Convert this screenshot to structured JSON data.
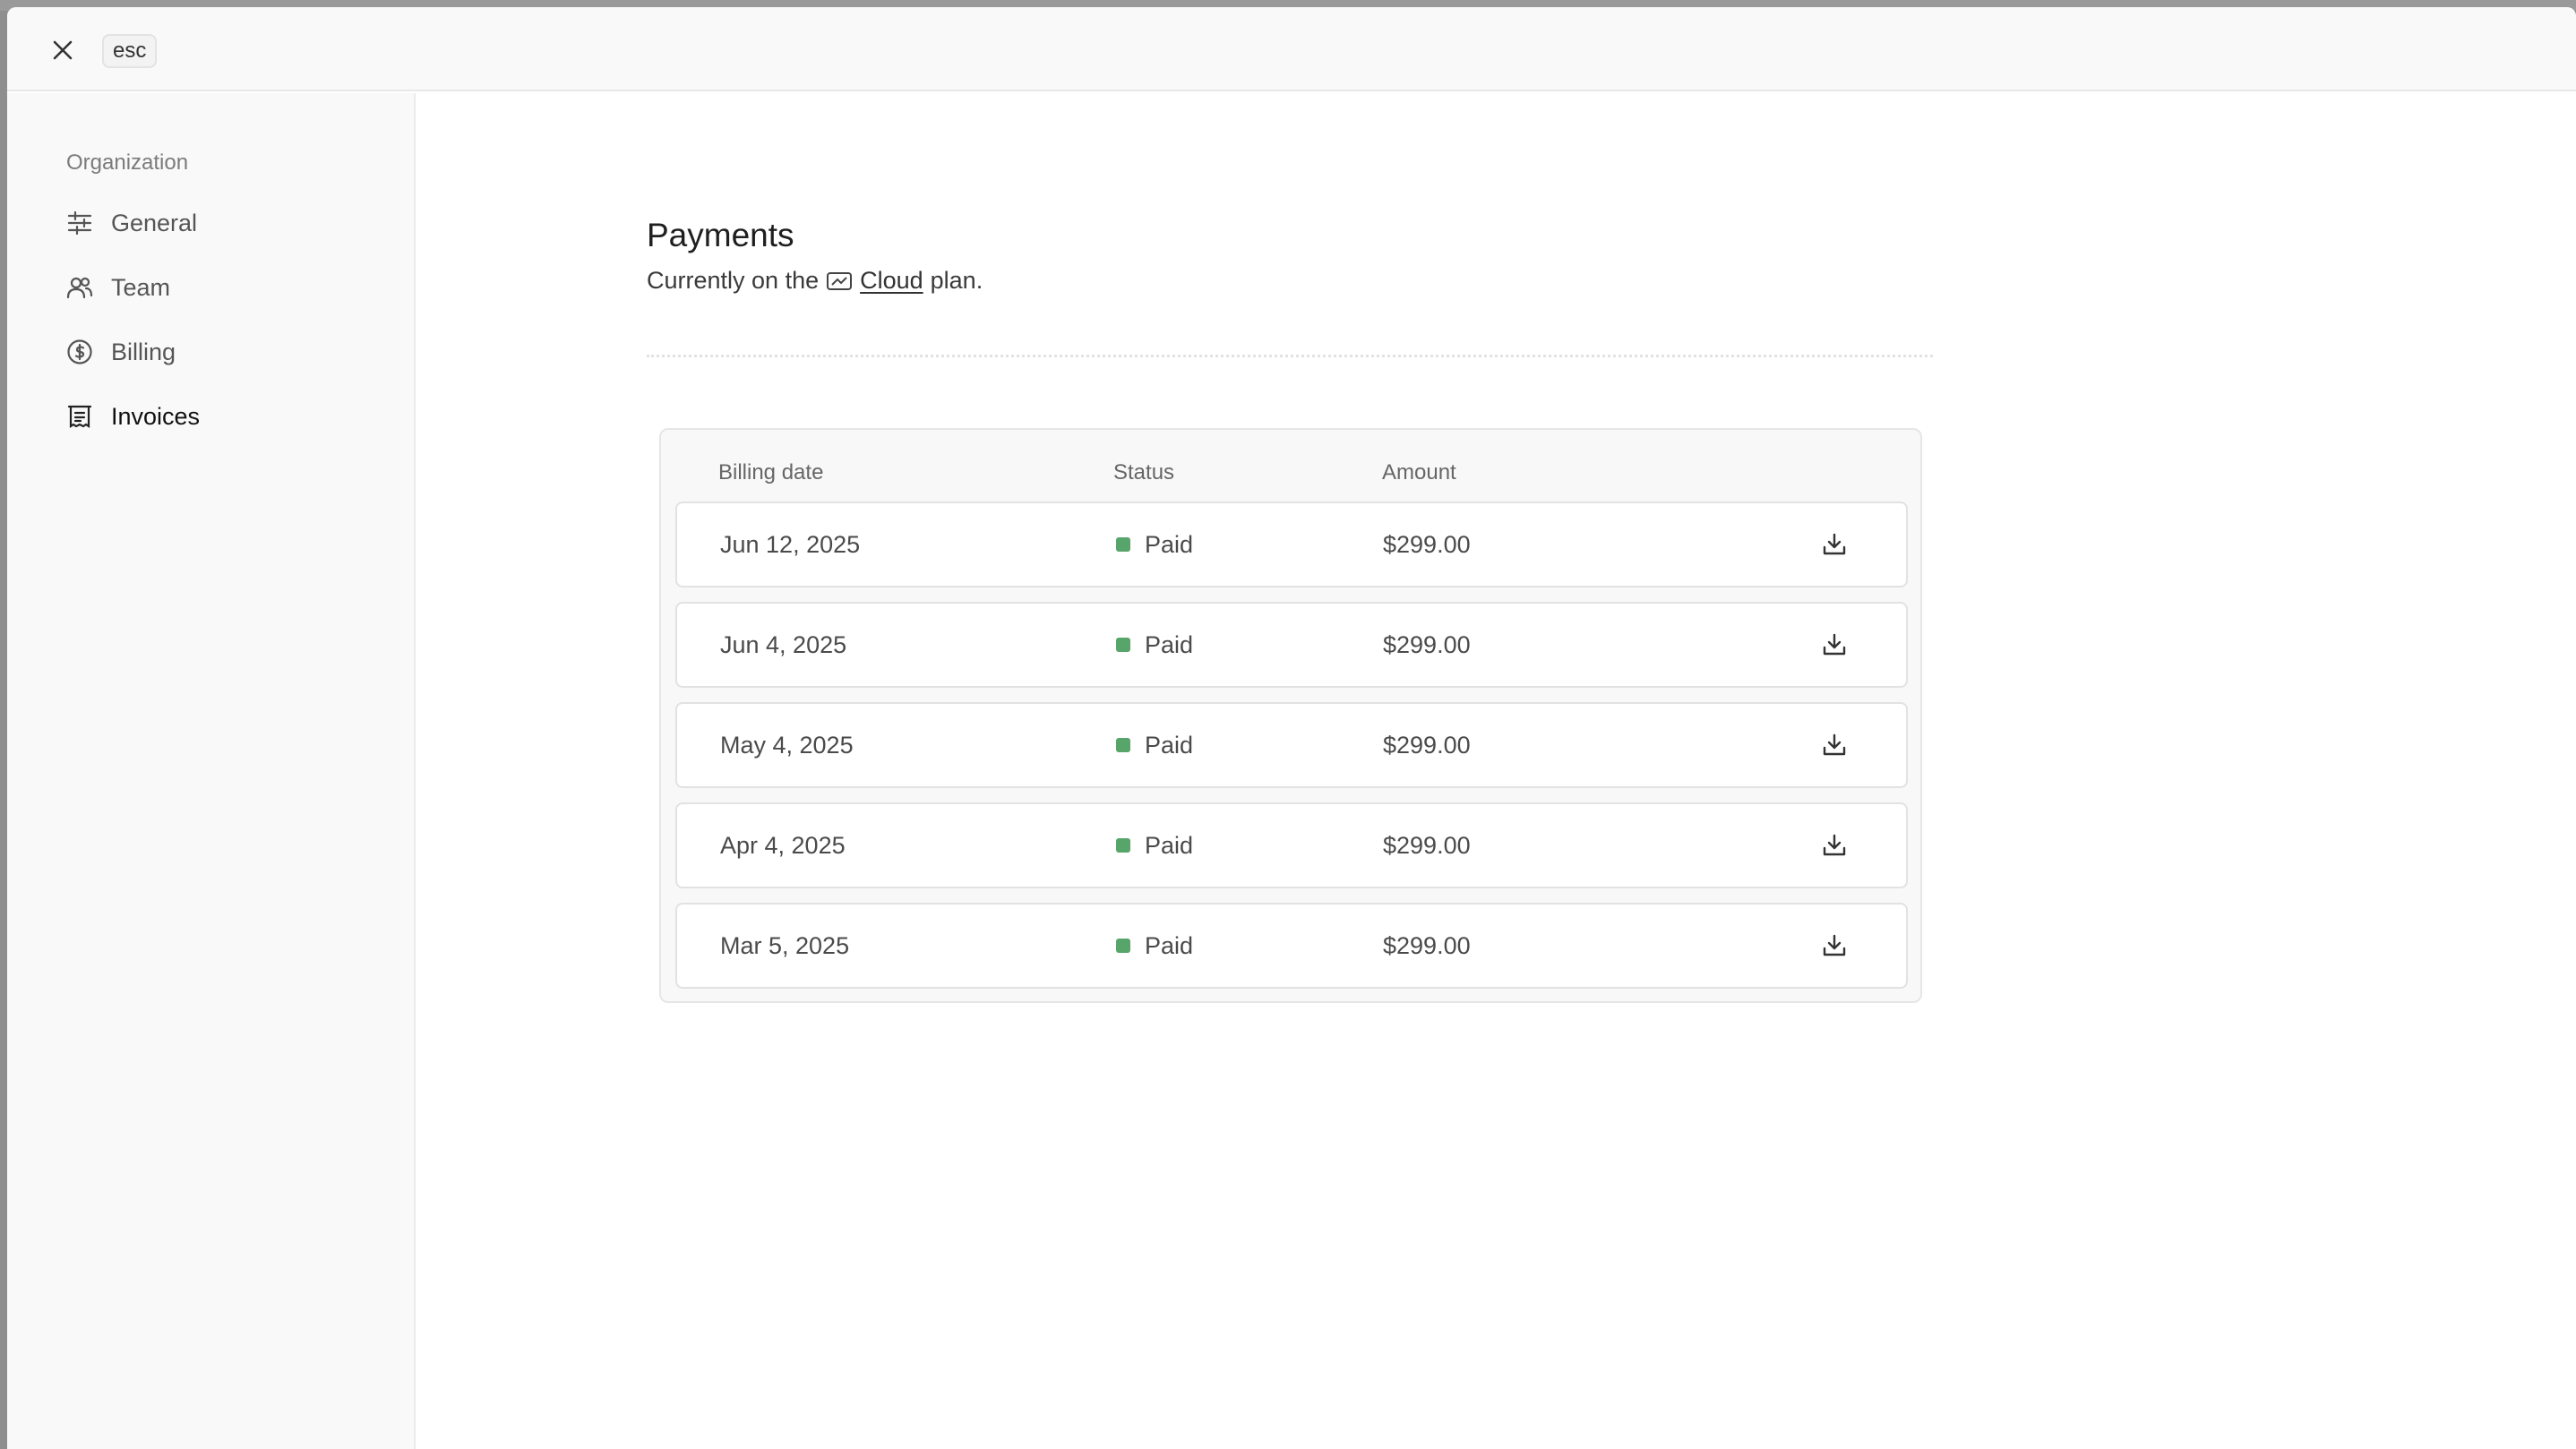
{
  "topbar": {
    "esc_label": "esc"
  },
  "sidebar": {
    "heading": "Organization",
    "items": [
      {
        "label": "General",
        "icon": "sliders-icon",
        "active": false
      },
      {
        "label": "Team",
        "icon": "users-icon",
        "active": false
      },
      {
        "label": "Billing",
        "icon": "dollar-circle-icon",
        "active": false
      },
      {
        "label": "Invoices",
        "icon": "receipt-icon",
        "active": true
      }
    ]
  },
  "main": {
    "title": "Payments",
    "plan_prefix": "Currently on the",
    "plan_name": "Cloud",
    "plan_suffix": "plan."
  },
  "invoices": {
    "columns": {
      "date": "Billing date",
      "status": "Status",
      "amount": "Amount"
    },
    "rows": [
      {
        "date": "Jun 12, 2025",
        "status": "Paid",
        "amount": "$299.00"
      },
      {
        "date": "Jun 4, 2025",
        "status": "Paid",
        "amount": "$299.00"
      },
      {
        "date": "May 4, 2025",
        "status": "Paid",
        "amount": "$299.00"
      },
      {
        "date": "Apr 4, 2025",
        "status": "Paid",
        "amount": "$299.00"
      },
      {
        "date": "Mar 5, 2025",
        "status": "Paid",
        "amount": "$299.00"
      }
    ]
  },
  "colors": {
    "paid_status": "#58a56b"
  }
}
